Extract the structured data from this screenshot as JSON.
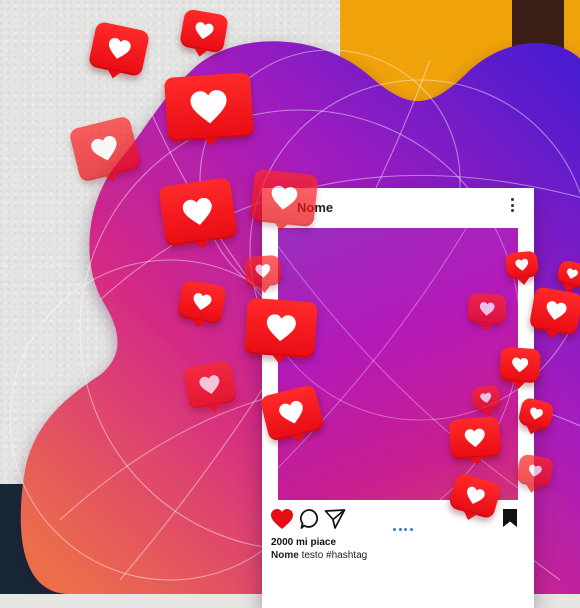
{
  "post": {
    "username": "Nome",
    "likes": "2000 mi piace",
    "caption_user": "Nome",
    "caption_text": "testo",
    "hashtag": "#hashtag"
  },
  "colors": {
    "orange": "#f0a20a",
    "brown": "#3b1f17",
    "navy": "#162833",
    "like_red": "#ff1e1e",
    "gradient": [
      "#5b21c8",
      "#b21cb8",
      "#e0345e",
      "#f08a3a"
    ]
  },
  "icons": [
    "heart-icon",
    "comment-icon",
    "share-icon",
    "more-options-icon",
    "bookmark-icon",
    "like-notification-icon"
  ]
}
